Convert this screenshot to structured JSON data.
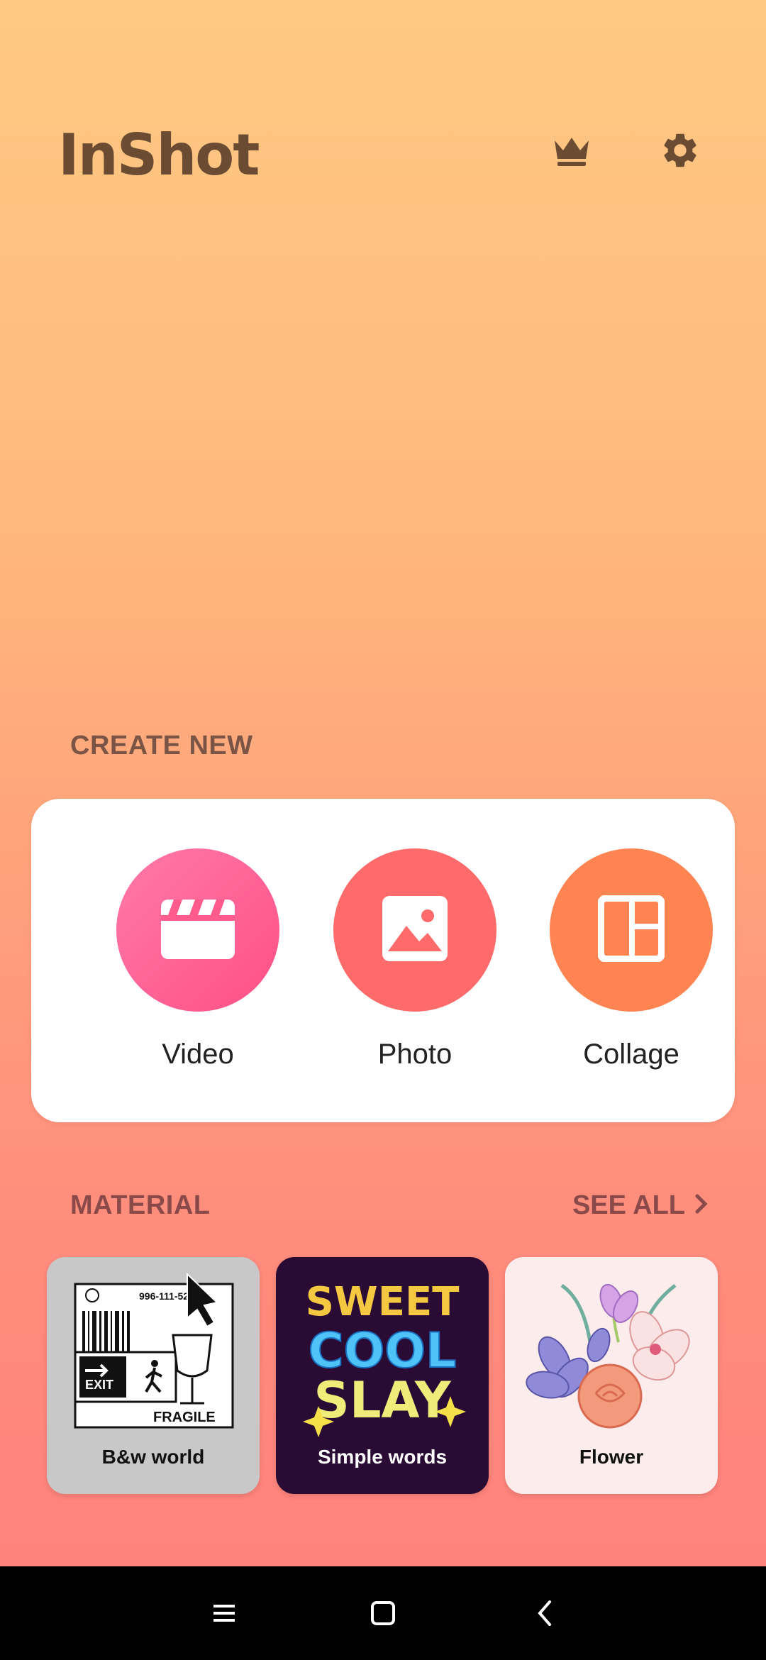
{
  "app": {
    "logo": "InShot"
  },
  "header": {
    "crown_icon": "crown-icon",
    "settings_icon": "gear-icon"
  },
  "create_new": {
    "title": "CREATE NEW",
    "items": [
      {
        "label": "Video",
        "icon": "clapperboard-icon",
        "color": "#ff5c8d"
      },
      {
        "label": "Photo",
        "icon": "image-icon",
        "color": "#ff6b6b"
      },
      {
        "label": "Collage",
        "icon": "collage-layout-icon",
        "color": "#ff8452"
      }
    ]
  },
  "material": {
    "title": "MATERIAL",
    "see_all": "SEE ALL",
    "items": [
      {
        "label": "B&w world",
        "art": {
          "phone": "996-111-525",
          "exit": "EXIT",
          "fragile": "FRAGILE"
        }
      },
      {
        "label": "Simple words",
        "art": {
          "line1": "SWEET",
          "line2": "COOL",
          "line3": "SLAY"
        }
      },
      {
        "label": "Flower"
      }
    ]
  },
  "navbar": {
    "menu_icon": "recent-apps-icon",
    "home_icon": "home-icon",
    "back_icon": "back-icon"
  }
}
